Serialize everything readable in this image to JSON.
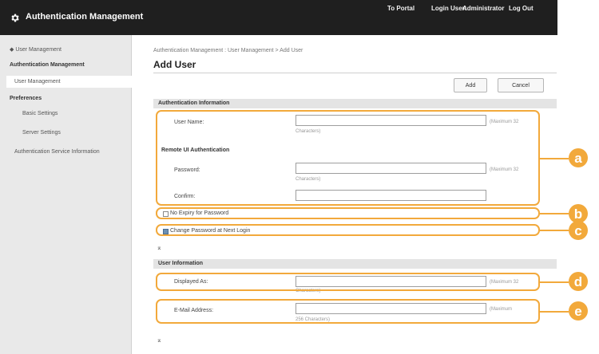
{
  "header": {
    "app_title": "Authentication Management",
    "to_portal": "To Portal",
    "login_user_label": "Login User:",
    "login_user_value": "Administrator",
    "logout": "Log Out"
  },
  "sidebar": {
    "items": [
      {
        "label": "◆ User Management",
        "kind": "link"
      },
      {
        "label": "Authentication Management",
        "kind": "heading"
      },
      {
        "label": "User Management",
        "kind": "selected"
      },
      {
        "label": "Preferences",
        "kind": "heading"
      },
      {
        "label": "Basic Settings",
        "kind": "link"
      },
      {
        "label": "Server Settings",
        "kind": "link"
      },
      {
        "label": "Authentication Service Information",
        "kind": "link"
      }
    ]
  },
  "main": {
    "breadcrumb": "Authentication Management : User Management > Add User",
    "title": "Add User",
    "add_button": "Add",
    "cancel_button": "Cancel",
    "auth_section": {
      "heading": "Authentication Information",
      "user_name_label": "User Name:",
      "user_name_hint_a": "(Maximum 32",
      "user_name_hint_b": "Characters)",
      "remote_ui_heading": "Remote UI Authentication",
      "password_label": "Password:",
      "password_hint_a": "(Maximum 32",
      "password_hint_b": "Characters)",
      "confirm_label": "Confirm:",
      "no_expiry_label": "No Expiry for Password",
      "no_expiry_checked": false,
      "change_password_label": "Change Password at Next Login",
      "change_password_checked": true
    },
    "user_info_section": {
      "heading": "User Information",
      "displayed_as_label": "Displayed As:",
      "displayed_as_hint_a": "(Maximum 32",
      "displayed_as_hint_b": "Characters)",
      "email_label": "E-Mail Address:",
      "email_hint_a": "(Maximum",
      "email_hint_b": "256 Characters)"
    },
    "collapse_icon": "double-chevron-up"
  },
  "callouts": [
    {
      "id": "a",
      "label": "a"
    },
    {
      "id": "b",
      "label": "b"
    },
    {
      "id": "c",
      "label": "c"
    },
    {
      "id": "d",
      "label": "d"
    },
    {
      "id": "e",
      "label": "e"
    }
  ],
  "colors": {
    "topbar": "#1f1f1f",
    "sidebar": "#e9e9e9",
    "section_header": "#e4e4e4",
    "callout": "#f2a93b",
    "checkbox_checked": "#6b8fb3"
  }
}
